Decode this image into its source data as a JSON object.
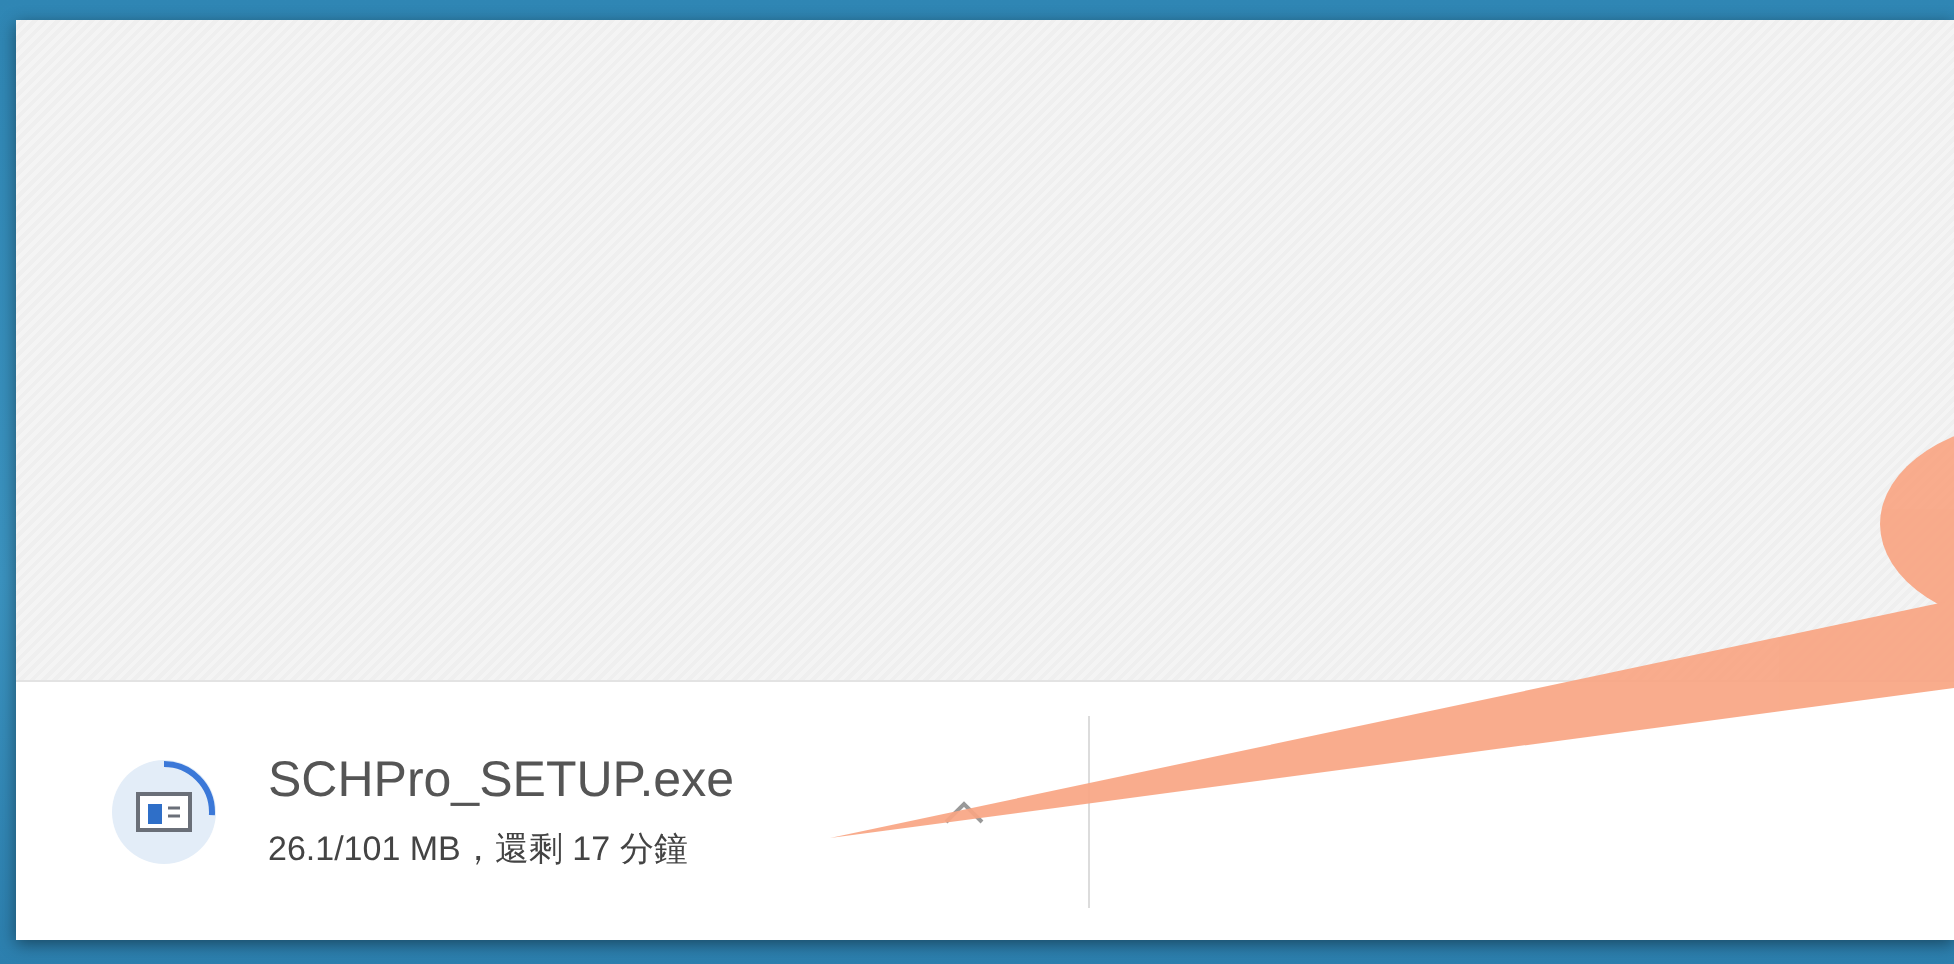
{
  "download": {
    "filename": "SCHPro_SETUP.exe",
    "status": "26.1/101 MB，還剩 17 分鐘",
    "level": 0.26
  }
}
